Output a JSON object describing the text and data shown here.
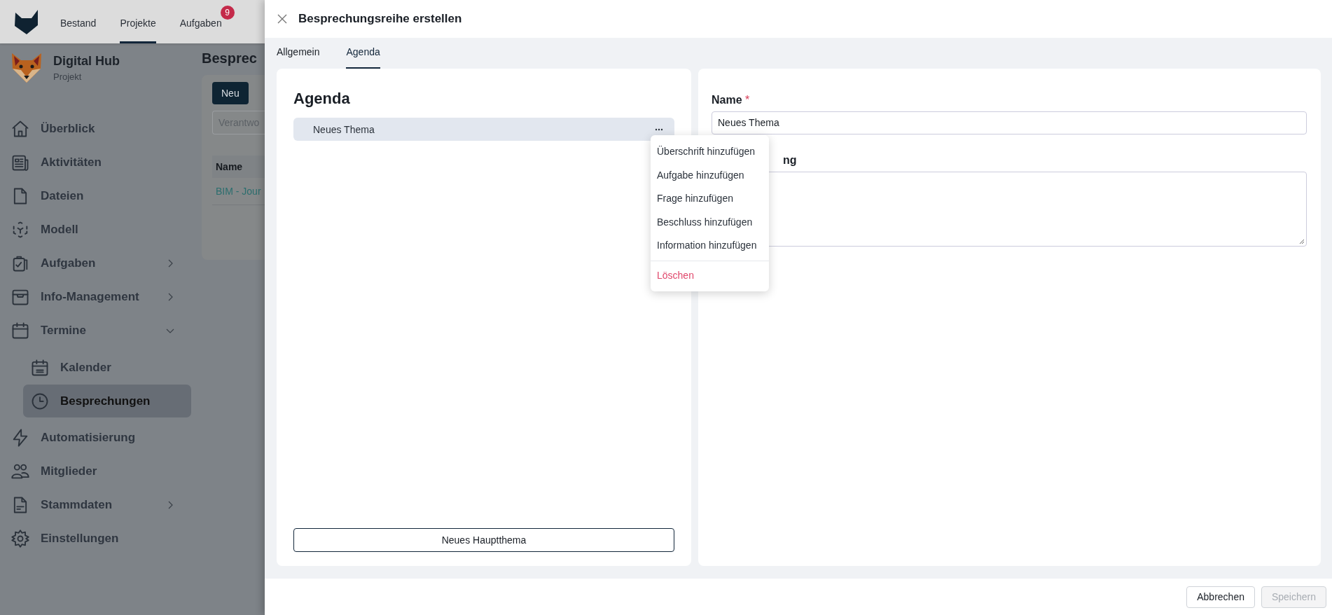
{
  "top_nav": {
    "items": [
      {
        "label": "Bestand",
        "selected": false
      },
      {
        "label": "Projekte",
        "selected": true
      },
      {
        "label": "Aufgaben",
        "selected": false,
        "badge": "9"
      }
    ]
  },
  "project": {
    "name": "Digital Hub",
    "type": "Projekt"
  },
  "sidebar": {
    "items": [
      {
        "label": "Überblick",
        "selected": false
      },
      {
        "label": "Aktivitäten",
        "selected": false
      },
      {
        "label": "Dateien",
        "selected": false
      },
      {
        "label": "Modell",
        "selected": false
      },
      {
        "label": "Aufgaben",
        "selected": false,
        "expanded": false
      },
      {
        "label": "Info-Management",
        "selected": false,
        "expanded": false
      },
      {
        "label": "Termine",
        "selected": false,
        "expanded": true,
        "children": [
          {
            "label": "Kalender",
            "selected": false
          },
          {
            "label": "Besprechungen",
            "selected": true
          }
        ]
      },
      {
        "label": "Automatisierung",
        "selected": false
      },
      {
        "label": "Mitglieder",
        "selected": false
      },
      {
        "label": "Stammdaten",
        "selected": false,
        "expanded": false
      },
      {
        "label": "Einstellungen",
        "selected": false
      }
    ]
  },
  "page": {
    "title": "Besprec",
    "new_button": "Neu",
    "filter_placeholder": "Verantwo",
    "table": {
      "columns": [
        "Name"
      ],
      "rows": [
        [
          "BIM - Jour"
        ]
      ]
    }
  },
  "dialog": {
    "title": "Besprechungsreihe erstellen",
    "tabs": [
      {
        "label": "Allgemein",
        "selected": false
      },
      {
        "label": "Agenda",
        "selected": true
      }
    ],
    "agenda": {
      "title": "Agenda",
      "topics": [
        {
          "label": "Neues Thema",
          "selected": true
        }
      ],
      "add_button": "Neues Hauptthema"
    },
    "context_menu": {
      "items": [
        {
          "label": "Überschrift hinzufügen",
          "kind": "action"
        },
        {
          "label": "Aufgabe hinzufügen",
          "kind": "action"
        },
        {
          "label": "Frage hinzufügen",
          "kind": "action"
        },
        {
          "label": "Beschluss hinzufügen",
          "kind": "action"
        },
        {
          "label": "Information hinzufügen",
          "kind": "action"
        },
        {
          "label": "Löschen",
          "kind": "danger"
        }
      ]
    },
    "form": {
      "name_label": "Name",
      "required_mark": "*",
      "name_value": "Neues Thema",
      "description_label": "ng"
    },
    "buttons": [
      {
        "label": "Abbrechen",
        "disabled": false
      },
      {
        "label": "Speichern",
        "disabled": true
      }
    ]
  }
}
